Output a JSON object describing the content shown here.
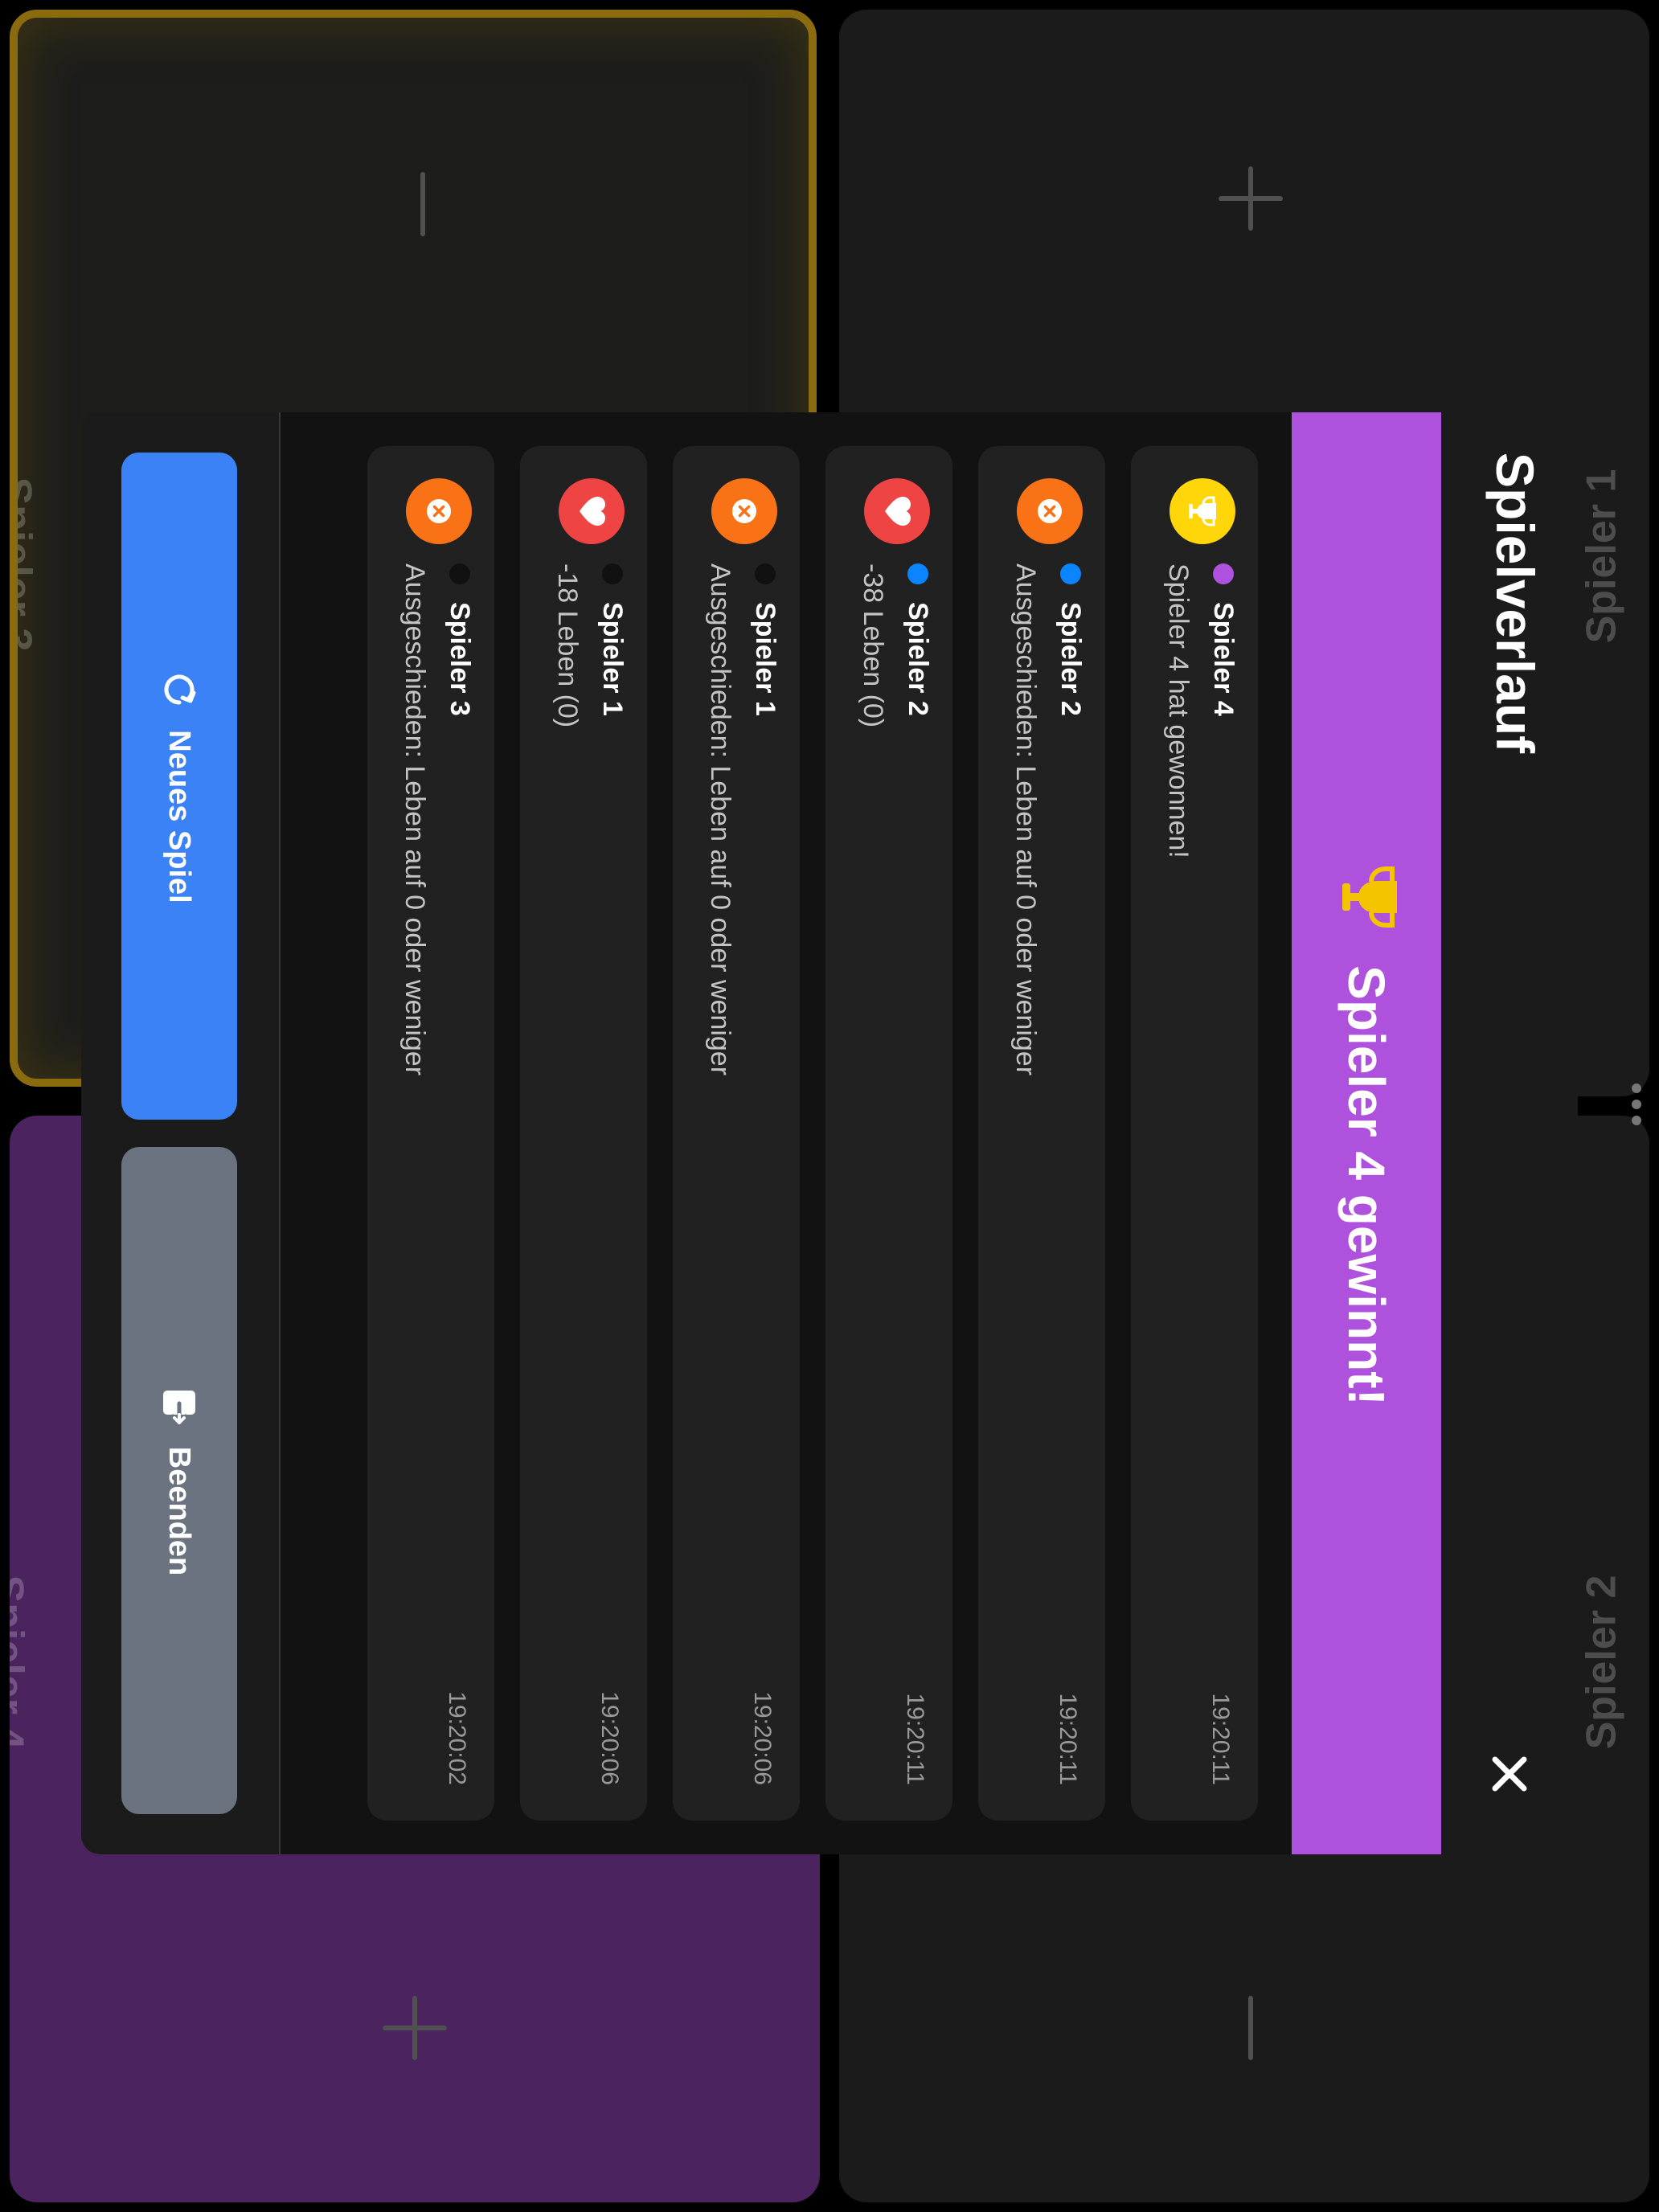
{
  "players": [
    {
      "name": "Spieler 3"
    },
    {
      "name": "Spieler 1"
    },
    {
      "name": "Spieler 4"
    },
    {
      "name": "Spieler 2"
    }
  ],
  "modal": {
    "title": "Spielverlauf",
    "winner_banner": "Spieler 4 gewinnt!",
    "colors": {
      "banner": "#ae51dc",
      "trophy": "#f5c400"
    },
    "history": [
      {
        "player": "Spieler 4",
        "dot_color": "#ae51dc",
        "icon": "trophy-icon",
        "icon_bg": "#ffd60a",
        "text": "Spieler 4 hat gewonnen!",
        "time": "19:20:11"
      },
      {
        "player": "Spieler 2",
        "dot_color": "#0a84ff",
        "icon": "x-circle-icon",
        "icon_bg": "#f97316",
        "text": "Ausgeschieden: Leben auf 0 oder weniger",
        "time": "19:20:11"
      },
      {
        "player": "Spieler 2",
        "dot_color": "#0a84ff",
        "icon": "heart-icon",
        "icon_bg": "#ef4444",
        "text": "-38 Leben (0)",
        "time": "19:20:11"
      },
      {
        "player": "Spieler 1",
        "dot_color": "#111111",
        "icon": "x-circle-icon",
        "icon_bg": "#f97316",
        "text": "Ausgeschieden: Leben auf 0 oder weniger",
        "time": "19:20:06"
      },
      {
        "player": "Spieler 1",
        "dot_color": "#111111",
        "icon": "heart-icon",
        "icon_bg": "#ef4444",
        "text": "-18 Leben (0)",
        "time": "19:20:06"
      },
      {
        "player": "Spieler 3",
        "dot_color": "#111111",
        "icon": "x-circle-icon",
        "icon_bg": "#f97316",
        "text": "Ausgeschieden: Leben auf 0 oder weniger",
        "time": "19:20:02"
      }
    ],
    "buttons": {
      "new_game": "Neues Spiel",
      "end": "Beenden"
    }
  }
}
